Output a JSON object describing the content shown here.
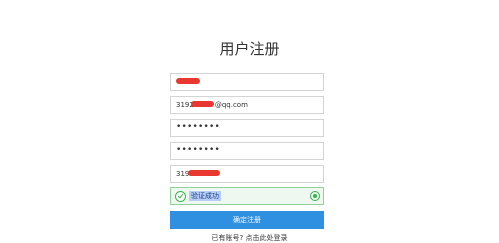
{
  "page": {
    "title": "用户注册"
  },
  "form": {
    "username": {
      "value": ""
    },
    "email": {
      "value": "3192",
      "suffix": "@qq.com"
    },
    "password": {
      "value": "••••••••"
    },
    "confirm_password": {
      "value": "••••••••"
    },
    "phone": {
      "value": "319"
    },
    "captcha": {
      "status_text": "验证成功"
    },
    "submit_label": "确定注册"
  },
  "footer": {
    "login_prompt": "已有账号? 点击此处登录"
  },
  "colors": {
    "accent": "#2f8fe0",
    "success": "#36b24b",
    "redaction": "#e8382f"
  }
}
